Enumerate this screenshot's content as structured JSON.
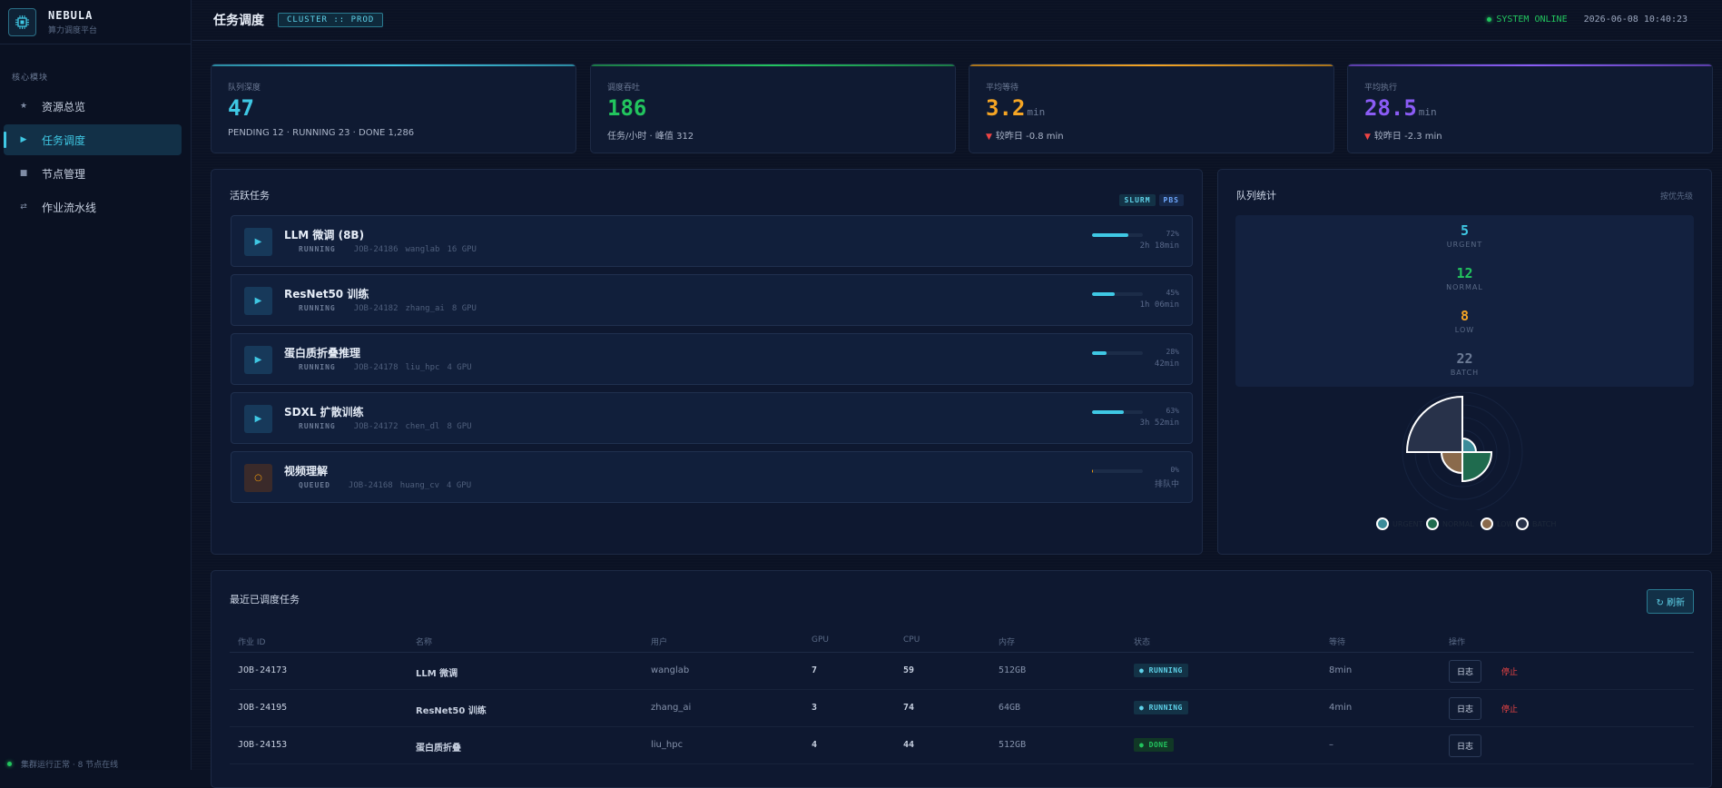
{
  "brand": {
    "name": "NEBULA",
    "subtitle": "算力调度平台"
  },
  "sidebar": {
    "section": "核心模块",
    "items": [
      {
        "icon": "★",
        "label": "资源总览"
      },
      {
        "icon": "▶",
        "label": "任务调度"
      },
      {
        "icon": "■",
        "label": "节点管理"
      },
      {
        "icon": "⇄",
        "label": "作业流水线"
      }
    ],
    "footer": "集群运行正常 · 8 节点在线"
  },
  "header": {
    "title": "任务调度",
    "cluster": "CLUSTER :: PROD",
    "status": "SYSTEM ONLINE",
    "datetime": "2026-06-08 10:40:23"
  },
  "stats": [
    {
      "label": "队列深度",
      "value": "47",
      "unit": "",
      "sub": "PENDING 12 · RUNNING 23 · DONE 1,286",
      "color": "#3fc8e4"
    },
    {
      "label": "调度吞吐",
      "value": "186",
      "unit": "",
      "sub": "任务/小时 · 峰值 312",
      "color": "#22c55e"
    },
    {
      "label": "平均等待",
      "value": "3.2",
      "unit": "min",
      "sub": "较昨日 -0.8 min",
      "color": "#f5a524"
    },
    {
      "label": "平均执行",
      "value": "28.5",
      "unit": "min",
      "sub": "较昨日 -2.3 min",
      "color": "#8b5cf6"
    }
  ],
  "active": {
    "title": "活跃任务",
    "tags": [
      "SLURM",
      "PBS"
    ],
    "tasks": [
      {
        "name": "LLM 微调 (8B)",
        "status": "RUNNING",
        "job": "JOB-24186",
        "user": "wanglab",
        "gpu": "16 GPU",
        "progress": 72,
        "pct": "72%",
        "time": "2h 18min"
      },
      {
        "name": "ResNet50 训练",
        "status": "RUNNING",
        "job": "JOB-24182",
        "user": "zhang_ai",
        "gpu": "8 GPU",
        "progress": 45,
        "pct": "45%",
        "time": "1h 06min"
      },
      {
        "name": "蛋白质折叠推理",
        "status": "RUNNING",
        "job": "JOB-24178",
        "user": "liu_hpc",
        "gpu": "4 GPU",
        "progress": 28,
        "pct": "28%",
        "time": "42min"
      },
      {
        "name": "SDXL 扩散训练",
        "status": "RUNNING",
        "job": "JOB-24172",
        "user": "chen_dl",
        "gpu": "8 GPU",
        "progress": 63,
        "pct": "63%",
        "time": "3h 52min"
      },
      {
        "name": "视频理解",
        "status": "QUEUED",
        "job": "JOB-24168",
        "user": "huang_cv",
        "gpu": "4 GPU",
        "progress": 0,
        "pct": "0%",
        "time": "排队中"
      }
    ]
  },
  "queue_stats": {
    "title": "队列统计",
    "mode": "按优先级",
    "items": [
      {
        "value": "5",
        "label": "URGENT",
        "color": "#3fc8e4"
      },
      {
        "value": "12",
        "label": "NORMAL",
        "color": "#22c55e"
      },
      {
        "value": "8",
        "label": "LOW",
        "color": "#f5a524"
      },
      {
        "value": "22",
        "label": "BATCH",
        "color": "#6b7a95"
      }
    ],
    "legend": [
      {
        "label": "URGENT",
        "color": "#3b8b99"
      },
      {
        "label": "NORMAL",
        "color": "#1f6b4e"
      },
      {
        "label": "LOW",
        "color": "#8a6a4c"
      },
      {
        "label": "BATCH",
        "color": "#28324a"
      }
    ]
  },
  "recent": {
    "title": "最近已调度任务",
    "refresh": "↻ 刷新",
    "columns": [
      "作业 ID",
      "名称",
      "用户",
      "GPU",
      "CPU",
      "内存",
      "状态",
      "等待",
      "操作"
    ],
    "rows": [
      {
        "id": "JOB-24173",
        "name": "LLM 微调",
        "user": "wanglab",
        "gpu": "7",
        "cpu": "59",
        "mem": "512GB",
        "status": "● RUNNING",
        "state": "running",
        "wait": "8min",
        "log": "日志",
        "stop": "停止"
      },
      {
        "id": "JOB-24195",
        "name": "ResNet50 训练",
        "user": "zhang_ai",
        "gpu": "3",
        "cpu": "74",
        "mem": "64GB",
        "status": "● RUNNING",
        "state": "running",
        "wait": "4min",
        "log": "日志",
        "stop": "停止"
      },
      {
        "id": "JOB-24153",
        "name": "蛋白质折叠",
        "user": "liu_hpc",
        "gpu": "4",
        "cpu": "44",
        "mem": "512GB",
        "status": "● DONE",
        "state": "done",
        "wait": "–",
        "log": "日志",
        "stop": ""
      }
    ]
  }
}
